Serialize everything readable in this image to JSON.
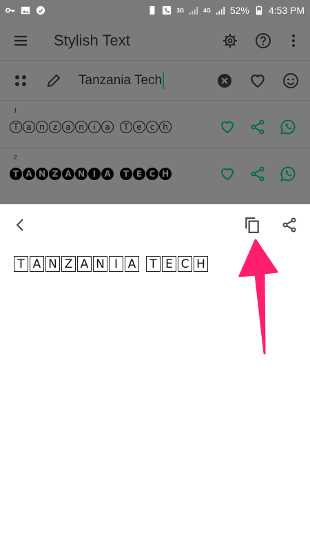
{
  "status_bar": {
    "network_3g": "3G",
    "network_4g": "4G",
    "battery": "52%",
    "time": "4:53 PM"
  },
  "app": {
    "title": "Stylish Text",
    "input_value": "Tanzania Tech",
    "results": [
      {
        "number": "1",
        "text": "Tanzania Tech",
        "style": "bubble-outline"
      },
      {
        "number": "2",
        "text": "TANZANIA TECH",
        "style": "bubble-filled"
      }
    ],
    "accent_color": "#00796b"
  },
  "sheet": {
    "preview_text": "TANZANIA TECH",
    "preview_style": "squared"
  },
  "icons": [
    "menu-icon",
    "gear-icon",
    "help-icon",
    "more-vert-icon",
    "drag-icon",
    "pencil-icon",
    "clear-icon",
    "heart-icon",
    "smiley-icon",
    "share-icon",
    "whatsapp-icon",
    "back-icon",
    "copy-icon",
    "pointer-arrow"
  ]
}
